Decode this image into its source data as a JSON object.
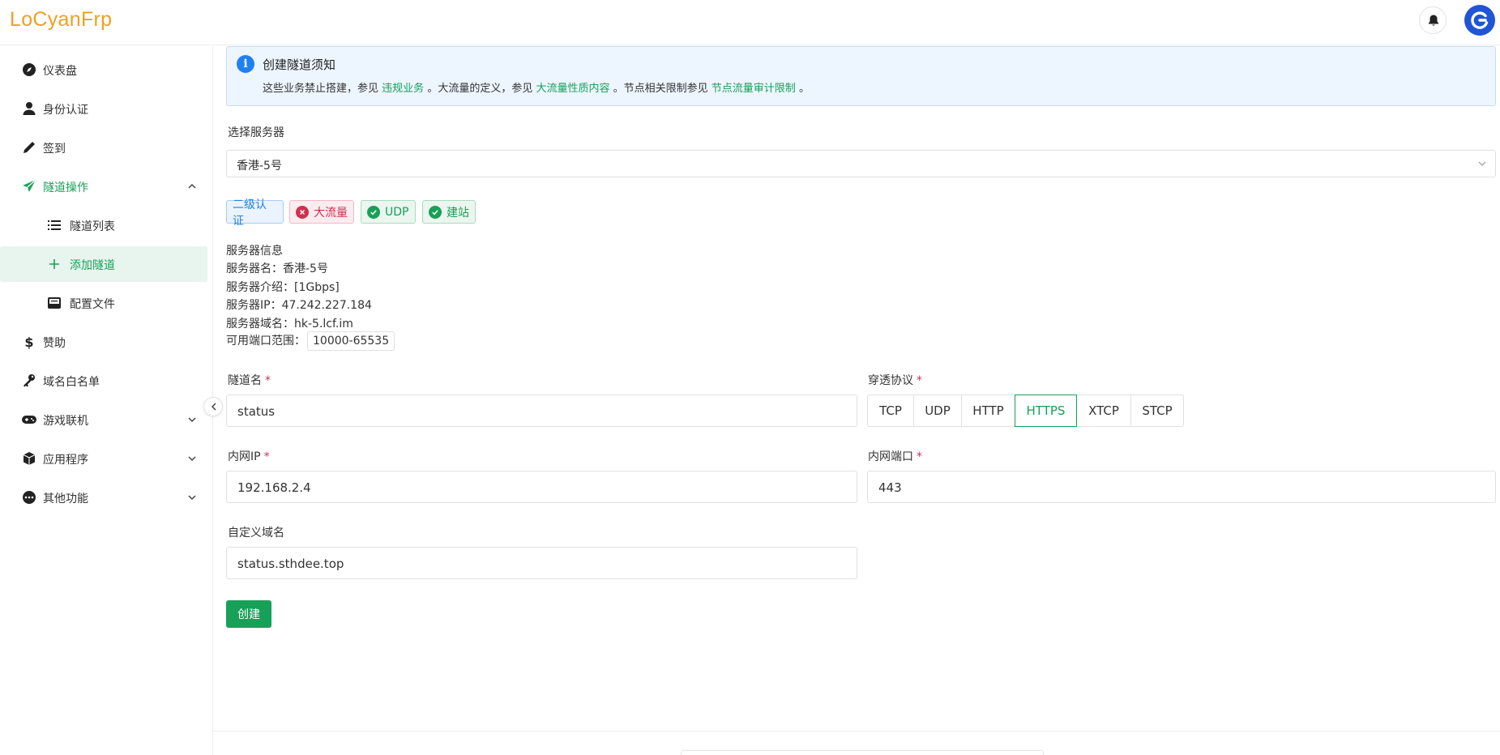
{
  "app": {
    "logo": "LoCyanFrp"
  },
  "sidebar": {
    "items": [
      {
        "label": "仪表盘",
        "icon": "compass-icon"
      },
      {
        "label": "身份认证",
        "icon": "user-icon"
      },
      {
        "label": "签到",
        "icon": "pen-icon"
      },
      {
        "label": "隧道操作",
        "icon": "paper-plane-icon",
        "expanded": true
      },
      {
        "label": "隧道列表",
        "icon": "list-icon"
      },
      {
        "label": "添加隧道",
        "icon": "plus-icon",
        "selected": true
      },
      {
        "label": "配置文件",
        "icon": "inbox-icon"
      },
      {
        "label": "赞助",
        "icon": "dollar-icon"
      },
      {
        "label": "域名白名单",
        "icon": "key-icon"
      },
      {
        "label": "游戏联机",
        "icon": "gamepad-icon"
      },
      {
        "label": "应用程序",
        "icon": "box-icon"
      },
      {
        "label": "其他功能",
        "icon": "more-icon"
      }
    ]
  },
  "notice": {
    "title": "创建隧道须知",
    "text1": "这些业务禁止搭建，参见",
    "link1": "违规业务",
    "text2": "。大流量的定义，参见",
    "link2": "大流量性质内容",
    "text3": "。节点相关限制参见",
    "link3": "节点流量审计限制",
    "text4": "。"
  },
  "server": {
    "label": "选择服务器",
    "selected": "香港-5号",
    "tags": [
      "二级认证",
      "大流量",
      "UDP",
      "建站"
    ],
    "info_title": "服务器信息",
    "name_line": "服务器名：香港-5号",
    "intro_line": "服务器介绍：[1Gbps]",
    "ip_line": "服务器IP：47.242.227.184",
    "domain_line": "服务器域名：hk-5.lcf.im",
    "port_range_label": "可用端口范围：",
    "port_range": "10000-65535"
  },
  "form": {
    "tunnel_name_label": "隧道名",
    "tunnel_name": "status",
    "protocol_label": "穿透协议",
    "protocols": [
      "TCP",
      "UDP",
      "HTTP",
      "HTTPS",
      "XTCP",
      "STCP"
    ],
    "selected_protocol": "HTTPS",
    "local_ip_label": "内网IP",
    "local_ip": "192.168.2.4",
    "local_port_label": "内网端口",
    "local_port": "443",
    "domain_label": "自定义域名",
    "domain": "status.sthdee.top",
    "required_mark": "*",
    "submit": "创建"
  },
  "colors": {
    "accent": "#18a058",
    "logo": "#f0a020",
    "info": "#2080f0",
    "error": "#d03050"
  }
}
